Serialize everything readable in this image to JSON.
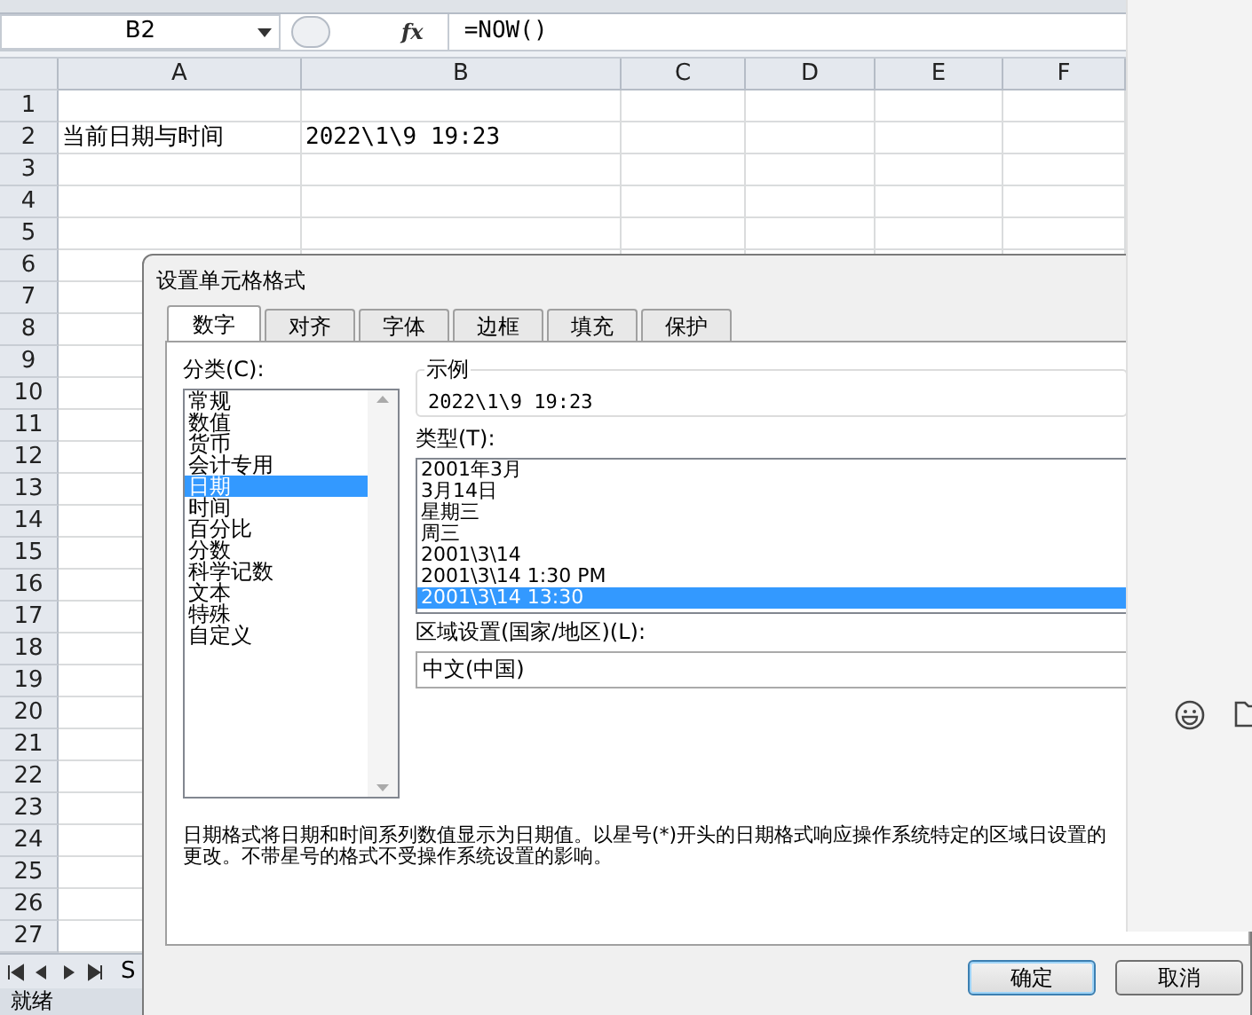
{
  "formula_bar": {
    "name_box": "B2",
    "function_label": "fx",
    "formula": "=NOW()"
  },
  "sheet": {
    "columns": [
      "A",
      "B",
      "C",
      "D",
      "E",
      "F"
    ],
    "rows": [
      {
        "label": "1",
        "cells": []
      },
      {
        "label": "2",
        "cells": [
          "当前日期与时间",
          "2022\\1\\9 19:23"
        ]
      },
      {
        "label": "3",
        "cells": []
      },
      {
        "label": "4",
        "cells": []
      },
      {
        "label": "5",
        "cells": []
      },
      {
        "label": "6",
        "cells": []
      },
      {
        "label": "7",
        "cells": []
      },
      {
        "label": "8",
        "cells": []
      },
      {
        "label": "9",
        "cells": []
      },
      {
        "label": "10",
        "cells": []
      },
      {
        "label": "11",
        "cells": []
      },
      {
        "label": "12",
        "cells": []
      },
      {
        "label": "13",
        "cells": []
      },
      {
        "label": "14",
        "cells": []
      },
      {
        "label": "15",
        "cells": []
      },
      {
        "label": "16",
        "cells": []
      },
      {
        "label": "17",
        "cells": []
      },
      {
        "label": "18",
        "cells": []
      },
      {
        "label": "19",
        "cells": []
      },
      {
        "label": "20",
        "cells": []
      },
      {
        "label": "21",
        "cells": []
      },
      {
        "label": "22",
        "cells": []
      },
      {
        "label": "23",
        "cells": []
      },
      {
        "label": "24",
        "cells": []
      },
      {
        "label": "25",
        "cells": []
      },
      {
        "label": "26",
        "cells": []
      },
      {
        "label": "27",
        "cells": []
      }
    ],
    "sheet_tab": "S",
    "status": "就绪"
  },
  "dialog": {
    "title": "设置单元格格式",
    "tabs": [
      {
        "label": "数字",
        "selected": true
      },
      {
        "label": "对齐",
        "selected": false
      },
      {
        "label": "字体",
        "selected": false
      },
      {
        "label": "边框",
        "selected": false
      },
      {
        "label": "填充",
        "selected": false
      },
      {
        "label": "保护",
        "selected": false
      }
    ],
    "category_label": "分类(C):",
    "categories": [
      {
        "label": "常规",
        "selected": false
      },
      {
        "label": "数值",
        "selected": false
      },
      {
        "label": "货币",
        "selected": false
      },
      {
        "label": "会计专用",
        "selected": false
      },
      {
        "label": "日期",
        "selected": true
      },
      {
        "label": "时间",
        "selected": false
      },
      {
        "label": "百分比",
        "selected": false
      },
      {
        "label": "分数",
        "selected": false
      },
      {
        "label": "科学记数",
        "selected": false
      },
      {
        "label": "文本",
        "selected": false
      },
      {
        "label": "特殊",
        "selected": false
      },
      {
        "label": "自定义",
        "selected": false
      }
    ],
    "sample": {
      "label": "示例",
      "value": "2022\\1\\9 19:23"
    },
    "type_label": "类型(T):",
    "types": [
      {
        "label": "2001年3月",
        "selected": false
      },
      {
        "label": "3月14日",
        "selected": false
      },
      {
        "label": "星期三",
        "selected": false
      },
      {
        "label": "周三",
        "selected": false
      },
      {
        "label": "2001\\3\\14",
        "selected": false
      },
      {
        "label": "2001\\3\\14 1:30 PM",
        "selected": false
      },
      {
        "label": "2001\\3\\14 13:30",
        "selected": true
      }
    ],
    "locale_label": "区域设置(国家/地区)(L):",
    "locale": "中文(中国)",
    "description": "日期格式将日期和时间系列数值显示为日期值。以星号(*)开头的日期格式响应操作系统特定的区域日设置的更改。不带星号的格式不受操作系统设置的影响。",
    "buttons": [
      "确定",
      "取消"
    ]
  }
}
